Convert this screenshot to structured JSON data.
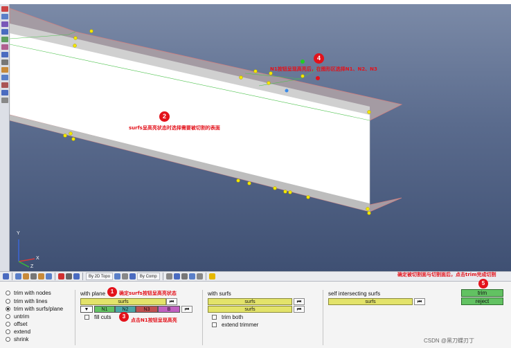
{
  "viewport": {
    "triad": {
      "y": "Y",
      "x": "X",
      "z": "Z"
    },
    "annotations": {
      "step2_badge": "2",
      "step2_text": "surfs呈高亮状态时选择需要被切割的表面",
      "step4_badge": "4",
      "step4_text": "N1按钮呈现高亮后，在图形区选择N1、N2、N3"
    }
  },
  "view_toolbar": {
    "topo_dropdown": "By 2D Topo",
    "comp_dropdown": "By Comp"
  },
  "panel": {
    "options": [
      {
        "label": "trim with nodes",
        "selected": false
      },
      {
        "label": "trim with lines",
        "selected": false
      },
      {
        "label": "trim with surfs/plane",
        "selected": true
      },
      {
        "label": "untrim",
        "selected": false
      },
      {
        "label": "offset",
        "selected": false
      },
      {
        "label": "extend",
        "selected": false
      },
      {
        "label": "shrink",
        "selected": false
      }
    ],
    "with_plane": {
      "label": "with plane",
      "surfs": "surfs",
      "dropdown_arrow": "▼",
      "nodes": [
        "N1",
        "N2",
        "N3",
        "B"
      ],
      "fill_cuts": "fill cuts"
    },
    "with_surfs": {
      "label": "with surfs",
      "surfs_1": "surfs",
      "surfs_2": "surfs",
      "trim_both": "trim both",
      "extend_trimmer": "extend trimmer"
    },
    "self_intersecting": {
      "label": "self intersecting surfs",
      "surfs": "surfs"
    },
    "actions": {
      "trim": "trim",
      "reject": "reject"
    },
    "annotations": {
      "step1_badge": "1",
      "step1_text": "确定surfs按钮呈高亮状态",
      "step3_badge": "3",
      "step3_text": "点击N1按钮呈现高亮",
      "step5_badge": "5",
      "step5_text": "确定被切割面与切割面后，点击trim完成切割"
    },
    "footer": "CSDN @黑刀蝶刃丁"
  },
  "colors": {
    "surfs_yellow": "#e3e36a",
    "n1_green": "#62c262",
    "n2_teal": "#4aa6a6",
    "n3_red": "#c05050",
    "b_magenta": "#c060c0",
    "annotation_red": "#e3121b"
  }
}
